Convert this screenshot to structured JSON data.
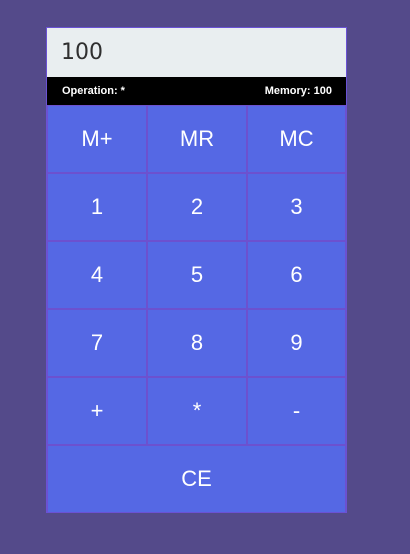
{
  "calculator": {
    "display_value": "100",
    "status": {
      "operation_label": "Operation: *",
      "memory_label": "Memory: 100"
    },
    "keys": {
      "memory_add": "M+",
      "memory_recall": "MR",
      "memory_clear": "MC",
      "digit_1": "1",
      "digit_2": "2",
      "digit_3": "3",
      "digit_4": "4",
      "digit_5": "5",
      "digit_6": "6",
      "digit_7": "7",
      "digit_8": "8",
      "digit_9": "9",
      "plus": "+",
      "multiply": "*",
      "minus": "-",
      "clear_entry": "CE"
    }
  },
  "colors": {
    "background": "#544a8a",
    "keypad": "#5568e4",
    "display": "#e9eef0",
    "status_bar": "#000000",
    "key_border": "#6c51cf"
  }
}
